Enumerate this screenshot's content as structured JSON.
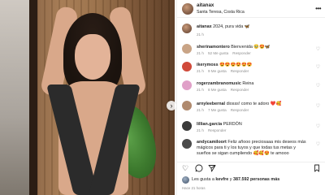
{
  "post": {
    "username": "aitanax",
    "location": "Santa Teresa, Costa Rica",
    "more_icon": "more-horizontal-icon"
  },
  "caption": {
    "username": "aitanax",
    "text": "2024, pura vida 🦋",
    "time": "21 h"
  },
  "comments": [
    {
      "username": "sherinamontero",
      "text": "Bienvenida 🥹😍🦋",
      "time": "21 h",
      "likes": "52 Me gusta",
      "reply": "Responder",
      "avatar_color": "#c9a486"
    },
    {
      "username": "ikerymoss",
      "text": "😍😍😍😍😍😍",
      "time": "21 h",
      "likes": "9 Me gusta",
      "reply": "Responder",
      "avatar_color": "#d04a3a"
    },
    {
      "username": "rogerzambranomusic",
      "text": "Reina",
      "time": "21 h",
      "likes": "8 Me gusta",
      "reply": "Responder",
      "avatar_color": "#e0a0c8"
    },
    {
      "username": "arnyleebernal",
      "text": "diosss! como te adoro ❤️🥰",
      "time": "21 h",
      "likes": "7 Me gusta",
      "reply": "Responder",
      "avatar_color": "#b08a6e"
    },
    {
      "username": "lillian.garcia",
      "text": "PERDÓN",
      "time": "21 h",
      "likes": "",
      "reply": "Responder",
      "avatar_color": "#3a3a3a"
    },
    {
      "username": "andycamiloort",
      "text": "Feliz añooo preciosaaa mis deseos más mágicos para ti y los tuyos y que todas tus metas y sueños se sigan cumpliendo 🥰🥰😍 te amooo",
      "time": "",
      "likes": "",
      "reply": "",
      "avatar_color": "#4a4a4a"
    }
  ],
  "actions": {
    "like_icon": "heart-outline-icon",
    "comment_icon": "comment-icon",
    "share_icon": "send-icon",
    "save_icon": "bookmark-icon"
  },
  "likes": {
    "prefix": "Les gusta a",
    "user": "kevfre",
    "joiner": "y",
    "count": "387.592 personas más"
  },
  "date": "Hace 21 horas"
}
